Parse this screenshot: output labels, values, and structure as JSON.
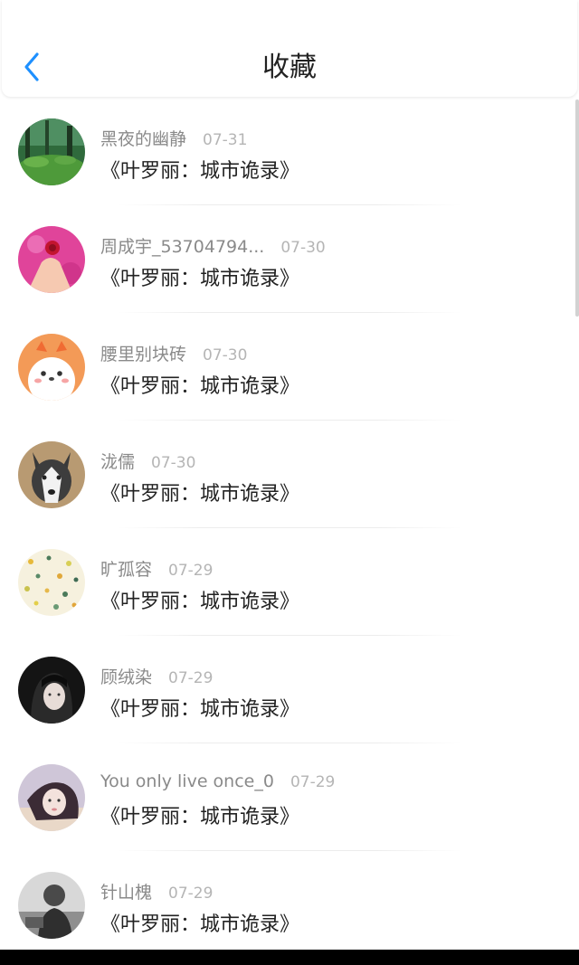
{
  "header": {
    "title": "收藏",
    "back_icon": "chevron-left-icon",
    "accent": "#1e90ff"
  },
  "items": [
    {
      "name": "黑夜的幽静",
      "date": "07-31",
      "work": "《叶罗丽：城市诡录》",
      "avatar": "forest"
    },
    {
      "name": "周成宇_53704794...",
      "date": "07-30",
      "work": "《叶罗丽：城市诡录》",
      "avatar": "pink"
    },
    {
      "name": "腰里别块砖",
      "date": "07-30",
      "work": "《叶罗丽：城市诡录》",
      "avatar": "dog-cartoon"
    },
    {
      "name": "泷儒",
      "date": "07-30",
      "work": "《叶罗丽：城市诡录》",
      "avatar": "husky"
    },
    {
      "name": "旷孤容",
      "date": "07-29",
      "work": "《叶罗丽：城市诡录》",
      "avatar": "pattern"
    },
    {
      "name": "顾绒染",
      "date": "07-29",
      "work": "《叶罗丽：城市诡录》",
      "avatar": "dark-portrait"
    },
    {
      "name": "You only live once_0",
      "date": "07-29",
      "work": "《叶罗丽：城市诡录》",
      "avatar": "girl-portrait"
    },
    {
      "name": "针山槐",
      "date": "07-29",
      "work": "《叶罗丽：城市诡录》",
      "avatar": "grayscale"
    }
  ]
}
